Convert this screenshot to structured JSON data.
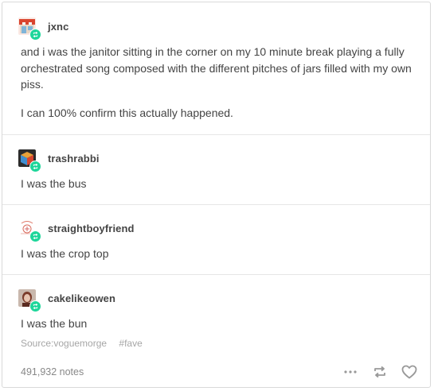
{
  "post": {
    "reblogs": [
      {
        "username": "jxnc",
        "avatar_icon": "storefront-avatar-icon",
        "paragraphs": [
          "and i was the janitor sitting in the corner on my 10 minute break playing a fully orchestrated song composed with the different pitches of jars filled with my own piss.",
          "I can 100% confirm this actually happened."
        ]
      },
      {
        "username": "trashrabbi",
        "avatar_icon": "cube-avatar-icon",
        "paragraphs": [
          "I was the bus"
        ]
      },
      {
        "username": "straightboyfriend",
        "avatar_icon": "sketch-avatar-icon",
        "paragraphs": [
          "I was the crop top"
        ]
      },
      {
        "username": "cakelikeowen",
        "avatar_icon": "photo-avatar-icon",
        "paragraphs": [
          "I was the bun"
        ]
      }
    ],
    "source_label": "Source:",
    "source_name": "voguemorge",
    "tag": "#fave",
    "notes": "491,932 notes",
    "actions": {
      "more_icon": "more-dots-icon",
      "reblog_icon": "reblog-icon",
      "like_icon": "heart-icon"
    },
    "colors": {
      "badge": "#1ed69a",
      "text": "#444444",
      "muted": "#a6a6a6"
    }
  }
}
